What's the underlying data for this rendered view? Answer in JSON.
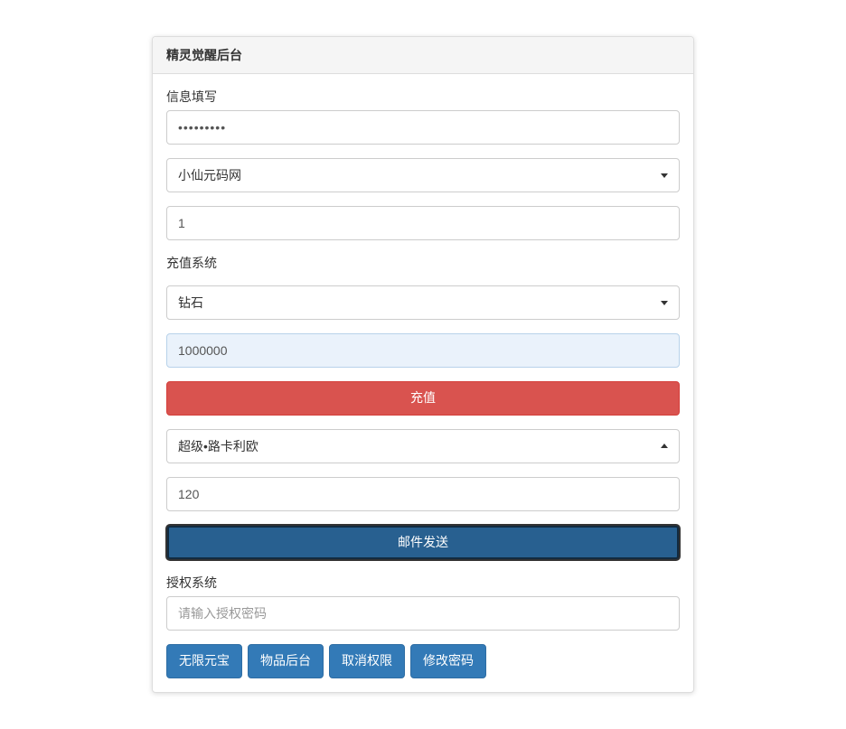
{
  "panel": {
    "title": "精灵觉醒后台"
  },
  "info": {
    "label": "信息填写",
    "password_value": "•••••••••",
    "server_select": "小仙元码网",
    "server_id": "1"
  },
  "recharge": {
    "label": "充值系统",
    "currency_select": "钻石",
    "amount": "1000000",
    "button": "充值"
  },
  "mail": {
    "item_select": "超级•路卡利欧",
    "quantity": "120",
    "button": "邮件发送"
  },
  "auth": {
    "label": "授权系统",
    "placeholder": "请输入授权密码"
  },
  "actions": {
    "unlimited_gold": "无限元宝",
    "item_backend": "物品后台",
    "cancel_auth": "取消权限",
    "change_password": "修改密码"
  }
}
